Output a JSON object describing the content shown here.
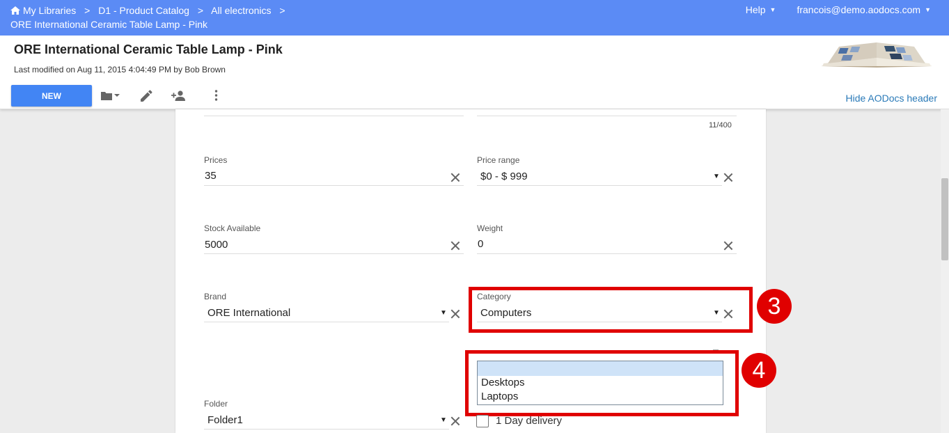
{
  "topbar": {
    "breadcrumb": [
      "My Libraries",
      "D1 - Product Catalog",
      "All electronics"
    ],
    "breadcrumb_sep": ">",
    "current": "ORE International Ceramic Table Lamp - Pink",
    "help_label": "Help",
    "user_label": "francois@demo.aodocs.com"
  },
  "header": {
    "title": "ORE International Ceramic Table Lamp - Pink",
    "last_modified": "Last modified on Aug 11, 2015 4:04:49 PM by Bob Brown",
    "new_button": "NEW",
    "hide_link": "Hide AODocs header"
  },
  "form": {
    "counter": "11/400",
    "prices": {
      "label": "Prices",
      "value": "35"
    },
    "price_range": {
      "label": "Price range",
      "value": "$0 - $ 999"
    },
    "stock": {
      "label": "Stock Available",
      "value": "5000"
    },
    "weight": {
      "label": "Weight",
      "value": "0"
    },
    "brand": {
      "label": "Brand",
      "value": "ORE International"
    },
    "category": {
      "label": "Category",
      "value": "Computers"
    },
    "subcategory_options": [
      "",
      "Desktops",
      "Laptops"
    ],
    "folder": {
      "label": "Folder",
      "value": "Folder1"
    },
    "delivery_label": "1 Day delivery"
  },
  "annotations": {
    "badge_3": "3",
    "badge_4": "4"
  },
  "colors": {
    "topbar": "#5b8bf5",
    "primary_button": "#4285f4",
    "highlight": "#e00000",
    "link": "#2a7ab8"
  }
}
